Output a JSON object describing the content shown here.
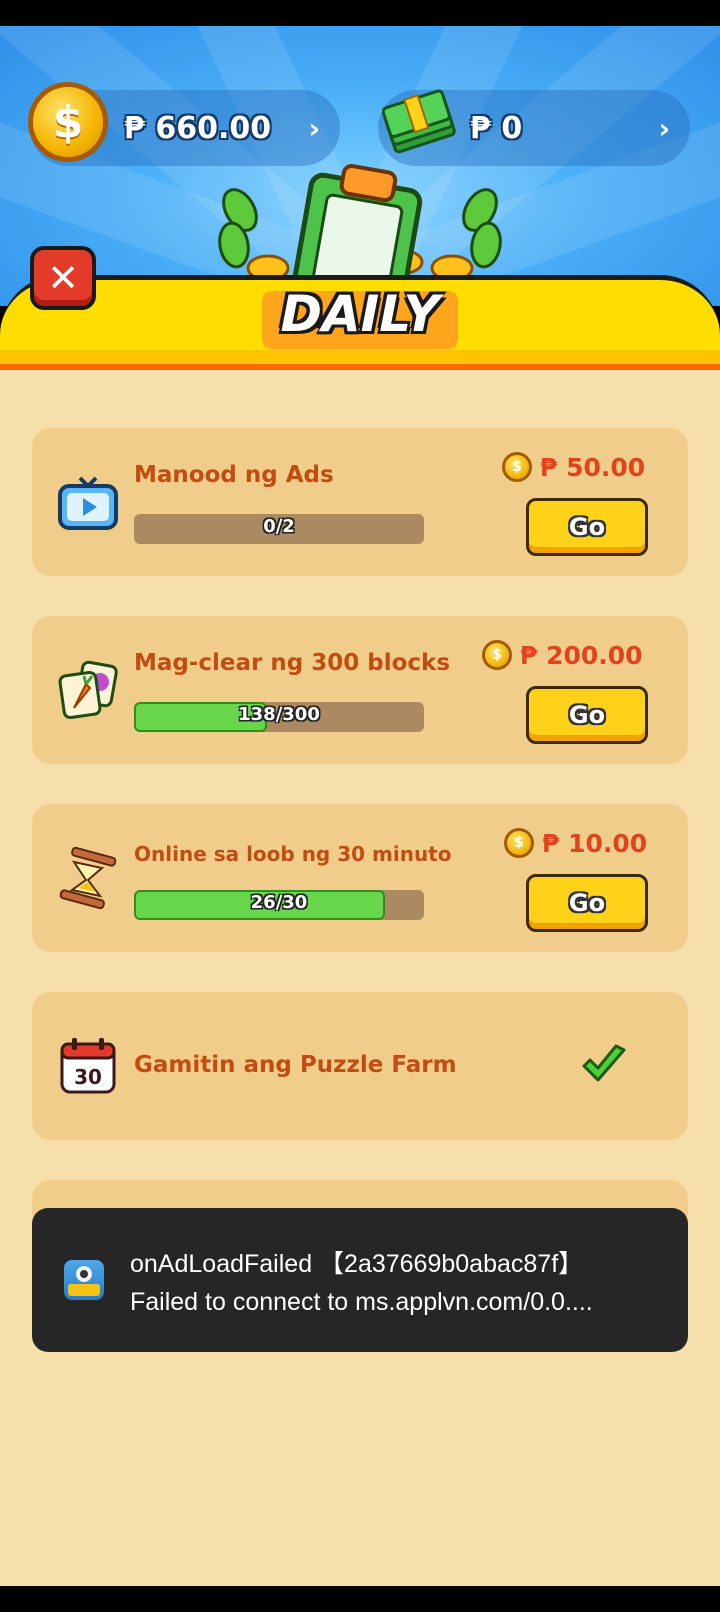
{
  "balances": {
    "coins": "₱ 660.00",
    "cash": "₱ 0",
    "chevron": "›"
  },
  "header": {
    "title": "DAILY",
    "close_label": "✕"
  },
  "tasks": [
    {
      "title": "Manood ng Ads",
      "progress_text": "0/2",
      "progress": 0.0,
      "reward": "₱ 50.00",
      "action": "Go",
      "icon": "tv-icon"
    },
    {
      "title": "Mag-clear ng 300 blocks",
      "progress_text": "138/300",
      "progress": 0.46,
      "reward": "₱ 200.00",
      "action": "Go",
      "icon": "carrot-tile-icon"
    },
    {
      "title": "Online sa loob ng 30 minuto",
      "progress_text": "26/30",
      "progress": 0.867,
      "reward": "₱ 10.00",
      "action": "Go",
      "icon": "hourglass-icon"
    },
    {
      "title": "Gamitin ang Puzzle Farm",
      "completed": true,
      "calendar_day": "30",
      "icon": "calendar-icon"
    }
  ],
  "toast": {
    "line1": "onAdLoadFailed 【2a37669b0abac87f】",
    "line2": "Failed to connect to ms.applvn.com/0.0....",
    "app_icon_text": "Puzzle Farm"
  },
  "colors": {
    "accent_yellow": "#ffdd00",
    "title_orange": "#c14d10",
    "reward_red": "#e2421c",
    "progress_green": "#68d64b",
    "sky_blue": "#49aef6"
  }
}
